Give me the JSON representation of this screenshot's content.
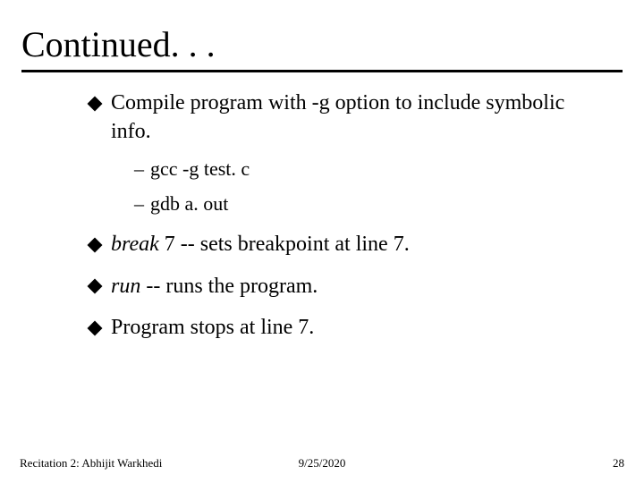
{
  "title": "Continued. . .",
  "bullets": {
    "b1": "Compile program with -g option to include symbolic info.",
    "b1_sub1": "gcc -g test. c",
    "b1_sub2": "gdb a. out",
    "b2_cmd": "break",
    "b2_rest": " 7 -- sets breakpoint at line 7.",
    "b3_cmd": "run",
    "b3_rest": " -- runs the program.",
    "b4": "Program stops at line 7."
  },
  "dash": "–",
  "footer": {
    "left": "Recitation 2: Abhijit Warkhedi",
    "center": "9/25/2020",
    "right": "28"
  }
}
